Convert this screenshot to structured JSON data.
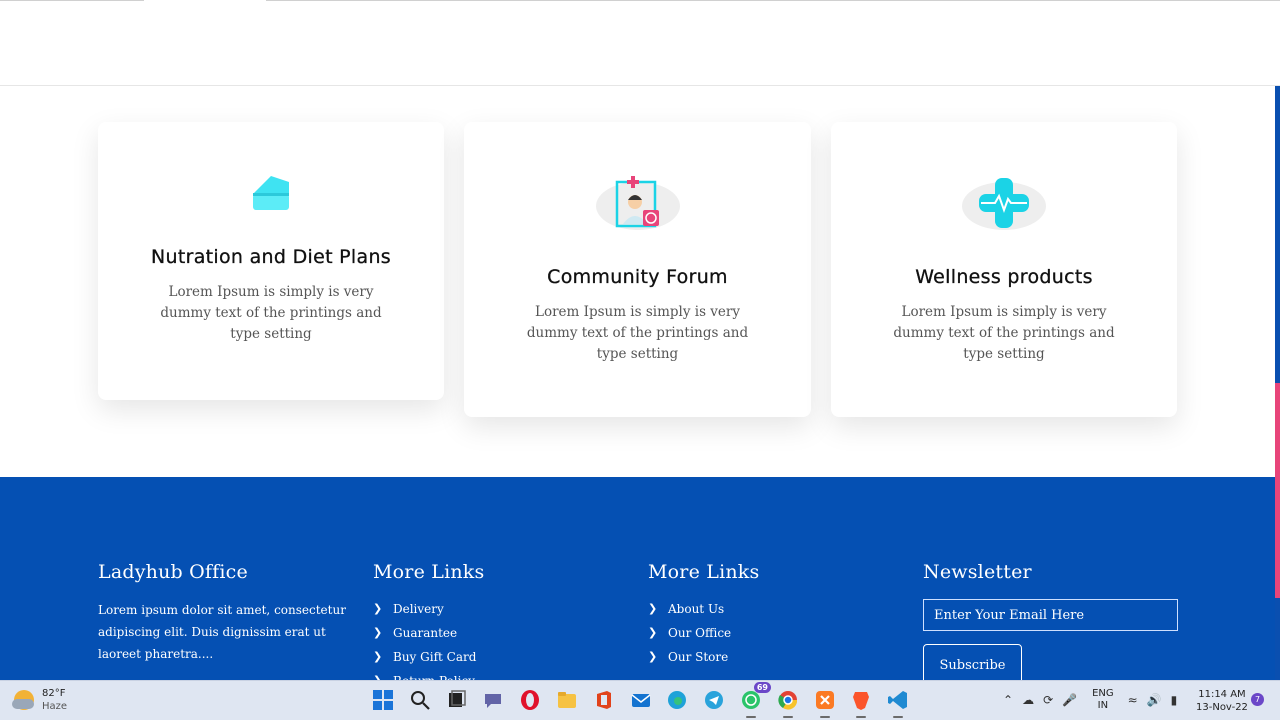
{
  "cards": [
    {
      "title": "Nutration and Diet Plans",
      "text": "Lorem Ipsum is simply is very dummy text of the printings and type setting",
      "icon": "cake-slice-icon"
    },
    {
      "title": "Community Forum",
      "text": "Lorem Ipsum is simply is very dummy text of the printings and type setting",
      "icon": "doctor-icon"
    },
    {
      "title": "Wellness products",
      "text": "Lorem Ipsum is simply is very dummy text of the printings and type setting",
      "icon": "medical-cross-icon"
    }
  ],
  "footer": {
    "office": {
      "heading": "Ladyhub Office",
      "text": "Lorem ipsum dolor sit amet, consectetur adipiscing elit. Duis dignissim erat ut laoreet pharetra...."
    },
    "links1": {
      "heading": "More Links",
      "items": [
        "Delivery",
        "Guarantee",
        "Buy Gift Card",
        "Return Policy"
      ]
    },
    "links2": {
      "heading": "More Links",
      "items": [
        "About Us",
        "Our Office",
        "Our Store"
      ]
    },
    "newsletter": {
      "heading": "Newsletter",
      "placeholder": "Enter Your Email Here",
      "button": "Subscribe"
    }
  },
  "taskbar": {
    "weather_temp": "82°F",
    "weather_desc": "Haze",
    "whatsapp_badge": "69",
    "lang_line1": "ENG",
    "lang_line2": "IN",
    "time": "11:14 AM",
    "date": "13-Nov-22",
    "notification_count": "7"
  },
  "colors": {
    "footer_bg": "#0550b3",
    "accent_pink": "#e8457a",
    "icon_cyan": "#1bd3e6"
  }
}
